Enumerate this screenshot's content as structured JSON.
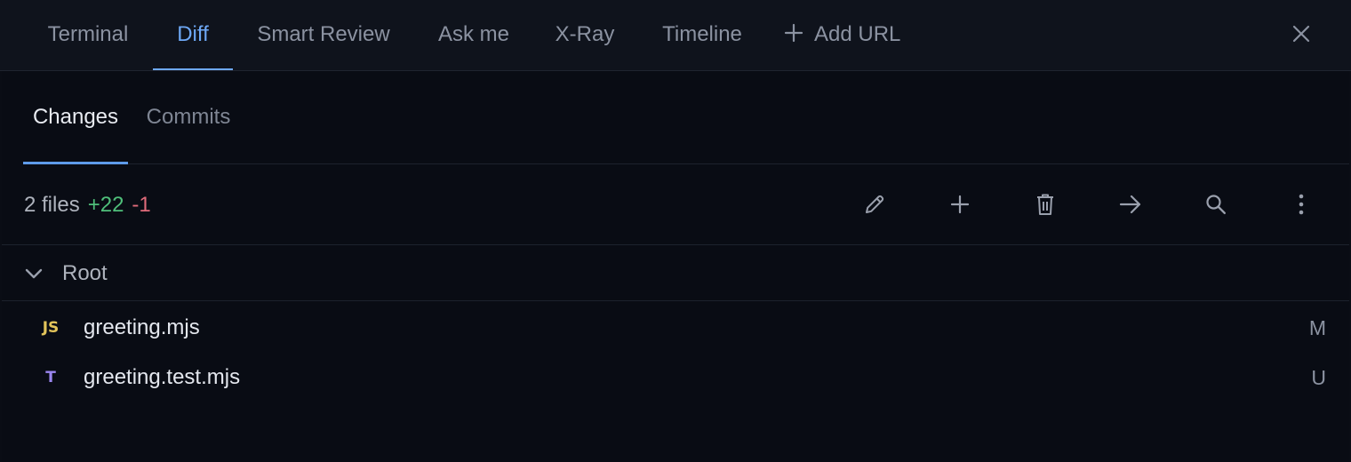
{
  "top_tabs": [
    {
      "label": "Terminal"
    },
    {
      "label": "Diff",
      "active": true
    },
    {
      "label": "Smart Review"
    },
    {
      "label": "Ask me"
    },
    {
      "label": "X-Ray"
    },
    {
      "label": "Timeline"
    }
  ],
  "add_url_label": "Add URL",
  "sub_tabs": [
    {
      "label": "Changes",
      "active": true
    },
    {
      "label": "Commits"
    }
  ],
  "summary": {
    "files": "2 files",
    "added": "+22",
    "removed": "-1"
  },
  "toolbar_icons": [
    "pencil-icon",
    "plus-icon",
    "trash-icon",
    "arrow-right-icon",
    "search-icon",
    "more-vertical-icon"
  ],
  "folder": {
    "label": "Root",
    "expanded": true
  },
  "files": [
    {
      "icon_text": "JS",
      "icon_color": "#e2c45a",
      "name": "greeting.mjs",
      "status": "M"
    },
    {
      "icon_text": "T",
      "icon_color": "#9a86f0",
      "name": "greeting.test.mjs",
      "status": "U"
    }
  ],
  "colors": {
    "accent": "#6ea8f5",
    "added": "#4fbf7a",
    "removed": "#e06b7a",
    "background": "#0a0d15"
  }
}
